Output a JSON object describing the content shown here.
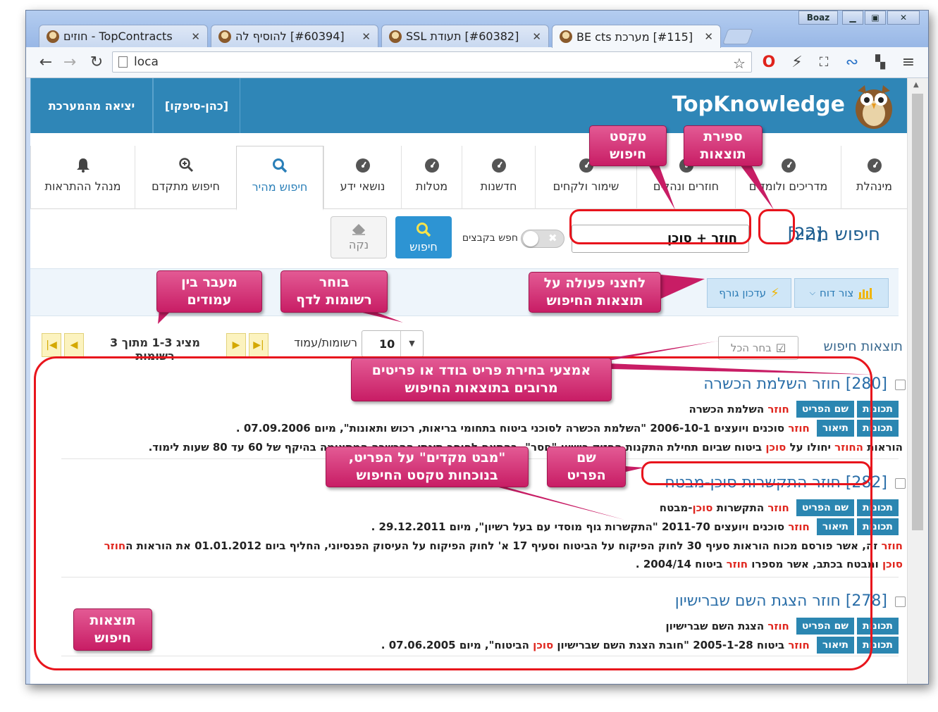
{
  "browser": {
    "user": "Boaz",
    "tabs": [
      {
        "title": "TopContracts - חוזים"
      },
      {
        "title": "[#60394] להוסיף לה"
      },
      {
        "title": "[#60382] תעודת SSL"
      },
      {
        "title": "[#115] מערכת BE cts"
      }
    ],
    "url": "loca"
  },
  "app": {
    "brand": "TopKnowledge",
    "header_links": [
      "כהן-סיפקו]]",
      "יציאה מהמערכת"
    ],
    "user_link": "[כהן-סיפקו]",
    "logout_link": "יציאה מהמערכת",
    "nav_tabs": [
      {
        "label": "מינהלת",
        "icon": "dashboard-icon"
      },
      {
        "label": "מדריכים ולומדים",
        "icon": "dashboard-icon"
      },
      {
        "label": "חוזרים ונהלים",
        "icon": "dashboard-icon"
      },
      {
        "label": "שימור ולקחים",
        "icon": "dashboard-icon"
      },
      {
        "label": "חדשנות",
        "icon": "dashboard-icon"
      },
      {
        "label": "מטלות",
        "icon": "dashboard-icon"
      },
      {
        "label": "נושאי ידע",
        "icon": "dashboard-icon"
      },
      {
        "label": "חיפוש מהיר",
        "icon": "search-icon"
      },
      {
        "label": "חיפוש מתקדם",
        "icon": "zoom-in-icon"
      },
      {
        "label": "מנהל ההתראות",
        "icon": "bell-icon"
      }
    ]
  },
  "quick_search": {
    "title": "חיפוש מהיר",
    "count": "[22]",
    "query": "חוזר + סוכן",
    "toggle_label": "חפש בקבצים",
    "search_button": "חיפוש",
    "clear_button": "נקה"
  },
  "actions": {
    "report_button": "צור דוח",
    "attach_button": "עדכון גורף"
  },
  "paging": {
    "results_label": "תוצאות חיפוש",
    "select_all": "בחר הכל",
    "per_page_label": "רשומות/עמוד",
    "per_page_value": "10",
    "status": "מציג 1-3 מתוך 3 רשומות"
  },
  "results": [
    {
      "title": "[280] חוזר השלמת הכשרה",
      "rows": [
        {
          "badges": [
            "תכונות",
            "שם הפריט"
          ],
          "parts": [
            [
              "חוזר",
              true
            ],
            [
              " השלמת הכשרה",
              false
            ]
          ]
        },
        {
          "badges": [
            "תכונות",
            "תיאור"
          ],
          "parts": [
            [
              "חוזר",
              true
            ],
            [
              " סוכנים ויועצים 2006-10-1 \"השלמת הכשרה לסוכני ביטוח בתחומי בריאות, רכוש ותאונות\", מיום 07.09.2006 .",
              false
            ]
          ]
        },
        {
          "badges": [],
          "parts": [
            [
              "הוראות ",
              false
            ],
            [
              "החוזר",
              true
            ],
            [
              " יחולו על ",
              false
            ],
            [
              "סוכן",
              true
            ],
            [
              " ביטוח שביום תחילת התקנות החזיק רישיון \"חסר\". בהתאם לחוסר תינתן ההכשרה המתאימה בהיקף של 60 עד 80 שעות לימוד.",
              false
            ]
          ]
        }
      ]
    },
    {
      "title": "[282] חוזר התקשרות סוכן-מבטח",
      "rows": [
        {
          "badges": [
            "תכונות",
            "שם הפריט"
          ],
          "parts": [
            [
              "חוזר",
              true
            ],
            [
              " התקשרות ",
              false
            ],
            [
              "סוכן",
              true
            ],
            [
              "-מבטח",
              false
            ]
          ]
        },
        {
          "badges": [
            "תכונות",
            "תיאור"
          ],
          "parts": [
            [
              "חוזר",
              true
            ],
            [
              " סוכנים ויועצים 2011-70 \"התקשרות גוף מוסדי עם בעל רשיון\", מיום 29.12.2011 .",
              false
            ]
          ]
        },
        {
          "badges": [],
          "parts": [
            [
              "חוזר",
              true
            ],
            [
              " זה, אשר פורסם מכוח הוראות סעיף 30 לחוק הפיקוח על הביטוח וסעיף 17 א' לחוק הפיקוח על העיסוק הפנסיוני, החליף ביום 01.01.2012 את הוראות ה",
              false
            ],
            [
              "חוזר",
              true
            ]
          ]
        },
        {
          "badges": [],
          "parts": [
            [
              "סוכן",
              true
            ],
            [
              " ומבטח בכתב, אשר מספרו ",
              false
            ],
            [
              "חוזר",
              true
            ],
            [
              " ביטוח 2004/14 .",
              false
            ]
          ]
        }
      ]
    },
    {
      "title": "[278] חוזר הצגת השם שברישיון",
      "rows": [
        {
          "badges": [
            "תכונות",
            "שם הפריט"
          ],
          "parts": [
            [
              "חוזר",
              true
            ],
            [
              " הצגת השם שברישיון",
              false
            ]
          ]
        },
        {
          "badges": [
            "תכונות",
            "תיאור"
          ],
          "parts": [
            [
              "חוזר",
              true
            ],
            [
              " ביטוח 2005-1-28 \"חובת הצגת השם שברישיון ",
              false
            ],
            [
              "סוכן",
              true
            ],
            [
              " הביטוח\", מיום 07.06.2005 .",
              false
            ]
          ]
        }
      ]
    }
  ],
  "annotations": {
    "search_text": "טקסט\nחיפוש",
    "result_count": "ספירת\nתוצאות",
    "action_buttons": "לחצני פעולה על\nתוצאות החיפוש",
    "records_per_page": "בוחר\nרשומות לדף",
    "page_switch": "מעבר בין\nעמודים",
    "selection": "אמצעי בחירת פריט בודד או פריטים\nמרובים בתוצאות החיפוש",
    "item_name": "שם\nהפריט",
    "preview": "\"מבט מקדים\" על הפריט,\nבנוכחות טקסט החיפוש",
    "search_results": "תוצאות\nחיפוש"
  },
  "colors": {
    "header": "#2f86b7",
    "callout": "#d0306f",
    "highlight": "#e0271f",
    "badge": "#2b86b1"
  }
}
